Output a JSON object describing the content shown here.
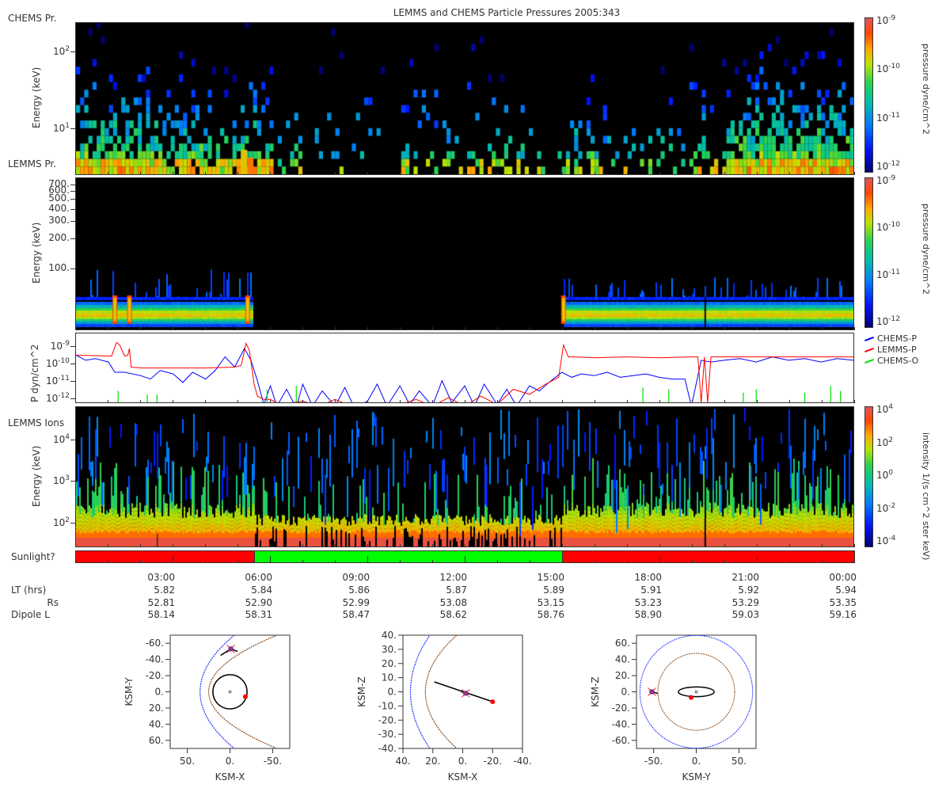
{
  "title": "LEMMS and CHEMS Particle Pressures  2005:343",
  "panel_labels": {
    "chems_pr": "CHEMS Pr.",
    "lemms_pr": "LEMMS Pr.",
    "lemms_ions": "LEMMS Ions",
    "sunlight": "Sunlight?"
  },
  "colors": {
    "chems_p": "#0000ff",
    "lemms_p": "#ff0000",
    "chems_o": "#00e000",
    "sunlight_yes": "#00ff00",
    "sunlight_no": "#ff0000"
  },
  "chart_data": [
    {
      "type": "heatmap",
      "name": "CHEMS pressure spectrogram",
      "ylabel": "Energy (keV)",
      "yscale": "log",
      "ylim": [
        2.5,
        240
      ],
      "yticks": [
        {
          "value": 100,
          "base": "10",
          "exp": "2"
        },
        {
          "value": 10,
          "base": "10",
          "exp": "1"
        }
      ],
      "xlim_hours": [
        0,
        24
      ],
      "activity_by_hour": [
        0.9,
        0.9,
        0.8,
        0.7,
        0.6,
        0.8,
        0.15,
        0.1,
        0.15,
        0.1,
        0.35,
        0.3,
        0.4,
        0.35,
        0.1,
        0.4,
        0.2,
        0.15,
        0.2,
        0.45,
        0.95,
        1,
        1,
        1
      ],
      "colorbar": {
        "label": "pressure dyne/cm^2",
        "ticks": [
          {
            "base": "10",
            "exp": "-9"
          },
          {
            "base": "10",
            "exp": "-10"
          },
          {
            "base": "10",
            "exp": "-11"
          },
          {
            "base": "10",
            "exp": "-12"
          }
        ],
        "range": [
          1e-12,
          1e-09
        ]
      }
    },
    {
      "type": "heatmap",
      "name": "LEMMS pressure spectrogram",
      "ylabel": "Energy (keV)",
      "yscale": "log",
      "ylim": [
        24,
        826
      ],
      "yticks": [
        {
          "value": 700,
          "label": "700."
        },
        {
          "value": 600,
          "label": "600."
        },
        {
          "value": 500,
          "label": "500."
        },
        {
          "value": 400,
          "label": "400."
        },
        {
          "value": 300,
          "label": "300."
        },
        {
          "value": 200,
          "label": "200."
        },
        {
          "value": 100,
          "label": "100."
        }
      ],
      "xlim_hours": [
        0,
        24
      ],
      "band_present_intervals_hours": [
        [
          0,
          5.45
        ],
        [
          15.05,
          24
        ]
      ],
      "intense_spikes_hours": [
        1.2,
        1.65,
        5.3,
        15.05
      ],
      "colorbar": {
        "label": "pressure dyne/cm^2",
        "ticks": [
          {
            "base": "10",
            "exp": "-9"
          },
          {
            "base": "10",
            "exp": "-10"
          },
          {
            "base": "10",
            "exp": "-11"
          },
          {
            "base": "10",
            "exp": "-12"
          }
        ],
        "range": [
          1e-12,
          1e-09
        ]
      }
    },
    {
      "type": "line",
      "name": "Partial pressures",
      "ylabel": "P dyn/cm^2",
      "yscale": "log",
      "ylim_log10": [
        -12.27,
        -8.22
      ],
      "yticks": [
        {
          "log10": -9,
          "base": "10",
          "exp": "-9"
        },
        {
          "log10": -10,
          "base": "10",
          "exp": "-10"
        },
        {
          "log10": -11,
          "base": "10",
          "exp": "-11"
        },
        {
          "log10": -12,
          "base": "10",
          "exp": "-12"
        }
      ],
      "legend": [
        "CHEMS-P",
        "LEMMS-P",
        "CHEMS-O"
      ],
      "legend_placement": "right",
      "series": [
        {
          "name": "CHEMS-P",
          "hours": [
            0,
            0.3,
            0.6,
            1,
            1.2,
            1.5,
            2,
            2.3,
            2.6,
            3,
            3.3,
            3.6,
            4,
            4.3,
            4.6,
            4.9,
            5.2,
            5.4,
            5.6,
            5.8,
            6,
            6.2,
            6.5,
            6.8,
            7,
            7.3,
            7.6,
            8,
            8.3,
            8.6,
            9,
            9.3,
            9.6,
            10,
            10.3,
            10.6,
            11,
            11.3,
            11.6,
            12,
            12.3,
            12.6,
            13,
            13.3,
            13.6,
            14,
            14.3,
            14.6,
            15,
            15.3,
            15.6,
            16,
            16.4,
            16.8,
            17.2,
            17.6,
            18,
            18.4,
            18.8,
            19,
            19.3,
            19.6,
            20,
            20.5,
            21,
            21.5,
            22,
            22.5,
            23,
            23.5,
            24
          ],
          "log10": [
            -9.5,
            -9.8,
            -9.7,
            -9.9,
            -10.5,
            -10.5,
            -10.7,
            -10.9,
            -10.4,
            -10.6,
            -11.1,
            -10.5,
            -10.9,
            -10.4,
            -9.6,
            -10.2,
            -9.1,
            -9.8,
            -11,
            -12.4,
            -11.3,
            -12.5,
            -11.5,
            -12.6,
            -11.2,
            -12.5,
            -11.6,
            -12.5,
            -11.4,
            -12.6,
            -12.2,
            -11.2,
            -12.5,
            -11.3,
            -12.4,
            -11.6,
            -12.5,
            -11,
            -12.3,
            -11.3,
            -12.5,
            -11.2,
            -12.4,
            -11.5,
            -12.5,
            -11.3,
            -11.6,
            -11.1,
            -10.5,
            -10.8,
            -10.6,
            -10.7,
            -10.5,
            -10.8,
            -10.7,
            -10.6,
            -10.8,
            -10.9,
            -10.9,
            -12.5,
            -9.8,
            -9.9,
            -9.8,
            -9.7,
            -9.9,
            -9.6,
            -9.8,
            -9.7,
            -9.9,
            -9.7,
            -9.8
          ]
        },
        {
          "name": "LEMMS-P",
          "hours": [
            0,
            1.1,
            1.25,
            1.35,
            1.5,
            1.6,
            1.65,
            1.7,
            2,
            3,
            4,
            4.9,
            5.1,
            5.25,
            5.35,
            5.5,
            5.6,
            5.8,
            6,
            6.3,
            7,
            7.5,
            8,
            8.5,
            9,
            10,
            10.5,
            11,
            11.5,
            12,
            12.5,
            13,
            13.5,
            14,
            14.5,
            14.9,
            15.05,
            15.2,
            15.4,
            16,
            17,
            18,
            19,
            19.2,
            19.3,
            19.4,
            19.5,
            19.6,
            20,
            21,
            22,
            23,
            24
          ],
          "log10": [
            -9.5,
            -9.55,
            -8.75,
            -8.9,
            -9.55,
            -9.5,
            -9.1,
            -10.2,
            -10.25,
            -10.25,
            -10.25,
            -10.2,
            -10.1,
            -8.8,
            -9.2,
            -11.2,
            -11.9,
            -12.1,
            -12.1,
            -12.4,
            -12.2,
            -12.5,
            -12.1,
            -12.5,
            -12.3,
            -12.4,
            -12.1,
            -12.5,
            -12.0,
            -12.5,
            -11.9,
            -12.4,
            -11.5,
            -11.8,
            -11.2,
            -10.8,
            -8.9,
            -9.6,
            -9.6,
            -9.65,
            -9.6,
            -9.65,
            -9.6,
            -9.6,
            -12.3,
            -9.6,
            -12.3,
            -9.6,
            -9.6,
            -9.6,
            -9.6,
            -9.6,
            -9.6
          ]
        },
        {
          "name": "CHEMS-O",
          "spike_hours": [
            1.3,
            2.2,
            2.5,
            5.9,
            6.8,
            17.5,
            18.3,
            20.6,
            21.0,
            22.5,
            23.3,
            23.6
          ],
          "spike_top_log10": [
            -11.6,
            -11.8,
            -11.8,
            -11.5,
            -11.3,
            -11.4,
            -11.5,
            -11.7,
            -11.5,
            -11.7,
            -11.3,
            -11.6
          ]
        }
      ]
    },
    {
      "type": "heatmap",
      "name": "LEMMS Ions spectrogram",
      "ylabel": "Energy (keV)",
      "yscale": "log",
      "ylim": [
        25,
        64500
      ],
      "yticks": [
        {
          "value": 10000,
          "base": "10",
          "exp": "4"
        },
        {
          "value": 1000,
          "base": "10",
          "exp": "3"
        },
        {
          "value": 100,
          "base": "10",
          "exp": "2"
        }
      ],
      "xlim_hours": [
        0,
        24
      ],
      "quiet_interval_hours": [
        5.5,
        15
      ],
      "colorbar": {
        "label": "intensity 1/(s cm^2 ster keV)",
        "ticks": [
          {
            "base": "10",
            "exp": "4"
          },
          {
            "base": "10",
            "exp": "2"
          },
          {
            "base": "10",
            "exp": "0"
          },
          {
            "base": "10",
            "exp": "-2"
          },
          {
            "base": "10",
            "exp": "-4"
          }
        ],
        "range": [
          1e-05,
          10000.0
        ]
      }
    },
    {
      "type": "bar",
      "name": "Sunlight",
      "intervals": [
        {
          "start": 0,
          "end": 5.5,
          "state": "no"
        },
        {
          "start": 5.5,
          "end": 15,
          "state": "yes"
        },
        {
          "start": 15,
          "end": 24,
          "state": "no"
        }
      ]
    },
    {
      "type": "scatter",
      "name": "Orbit X-Y",
      "xlabel": "KSM-X",
      "ylabel": "KSM-Y",
      "xlim": [
        70,
        -70
      ],
      "ylim": [
        -70,
        70
      ],
      "xticks": [
        "50.",
        "0.",
        "-50."
      ],
      "xtick_values": [
        50,
        0,
        -50
      ],
      "yticks": [
        "-60.",
        "-40.",
        "-20.",
        "0.",
        "20.",
        "40.",
        "60."
      ],
      "ytick_values": [
        -60,
        -40,
        -20,
        0,
        20,
        40,
        60
      ],
      "bow_shock": {
        "nose": 35,
        "edge_x": -5,
        "edge": 70
      },
      "magnetopause": {
        "nose": 25,
        "edge_x": -55,
        "edge": 70
      },
      "orbit_circle_radius": 20,
      "spacecraft": [
        -1,
        -53
      ],
      "trajectory": [
        [
          -9,
          -50
        ],
        [
          -1,
          -53
        ],
        [
          11,
          -45
        ]
      ],
      "marker": [
        -18,
        6
      ]
    },
    {
      "type": "scatter",
      "name": "Orbit X-Z",
      "xlabel": "KSM-X",
      "ylabel": "KSM-Z",
      "xlim": [
        40,
        -40
      ],
      "ylim": [
        40,
        -40
      ],
      "xticks": [
        "40.",
        "20.",
        "0.",
        "-20.",
        "-40."
      ],
      "xtick_values": [
        40,
        20,
        0,
        -20,
        -40
      ],
      "yticks": [
        "40.",
        "30.",
        "20.",
        "10.",
        "0.",
        "-10.",
        "-20.",
        "-30.",
        "-40."
      ],
      "ytick_values": [
        40,
        30,
        20,
        10,
        0,
        -10,
        -20,
        -30,
        -40
      ],
      "bow_shock": {
        "nose": 35,
        "edge_x": 22,
        "edge": 40
      },
      "magnetopause": {
        "nose": 25,
        "edge_x": 4,
        "edge": 40
      },
      "spacecraft": [
        -2,
        -1
      ],
      "trajectory": [
        [
          19,
          7
        ],
        [
          -20,
          -7
        ]
      ],
      "marker": [
        -20,
        -7
      ]
    },
    {
      "type": "scatter",
      "name": "Orbit Y-Z",
      "xlabel": "KSM-Y",
      "ylabel": "KSM-Z",
      "xlim": [
        -70,
        70
      ],
      "ylim": [
        70,
        -70
      ],
      "xticks": [
        "-50.",
        "0.",
        "50."
      ],
      "xtick_values": [
        -50,
        0,
        50
      ],
      "yticks": [
        "60.",
        "40.",
        "20.",
        "0.",
        "-20.",
        "-40.",
        "-60."
      ],
      "ytick_values": [
        60,
        40,
        20,
        0,
        -20,
        -40,
        -60
      ],
      "bow_shock_radius": 66,
      "magnetopause_radius": 45,
      "orbit_ellipse": [
        21,
        6
      ],
      "spacecraft": [
        -52,
        0
      ],
      "trajectory": [
        [
          -52,
          0
        ],
        [
          -45,
          -2
        ]
      ],
      "marker": [
        -6,
        -7
      ]
    }
  ],
  "time_axis": {
    "ticks": [
      "03:00",
      "06:00",
      "09:00",
      "12:00",
      "15:00",
      "18:00",
      "21:00",
      "00:00"
    ],
    "tick_hours": [
      3,
      6,
      9,
      12,
      15,
      18,
      21,
      24
    ],
    "rows": [
      {
        "label": "LT (hrs)",
        "values": [
          "5.82",
          "5.84",
          "5.86",
          "5.87",
          "5.89",
          "5.91",
          "5.92",
          "5.94"
        ]
      },
      {
        "label": "Rs",
        "values": [
          "52.81",
          "52.90",
          "52.99",
          "53.08",
          "53.15",
          "53.23",
          "53.29",
          "53.35"
        ]
      },
      {
        "label": "Dipole L",
        "values": [
          "58.14",
          "58.31",
          "58.47",
          "58.62",
          "58.76",
          "58.90",
          "59.03",
          "59.16"
        ]
      }
    ]
  }
}
